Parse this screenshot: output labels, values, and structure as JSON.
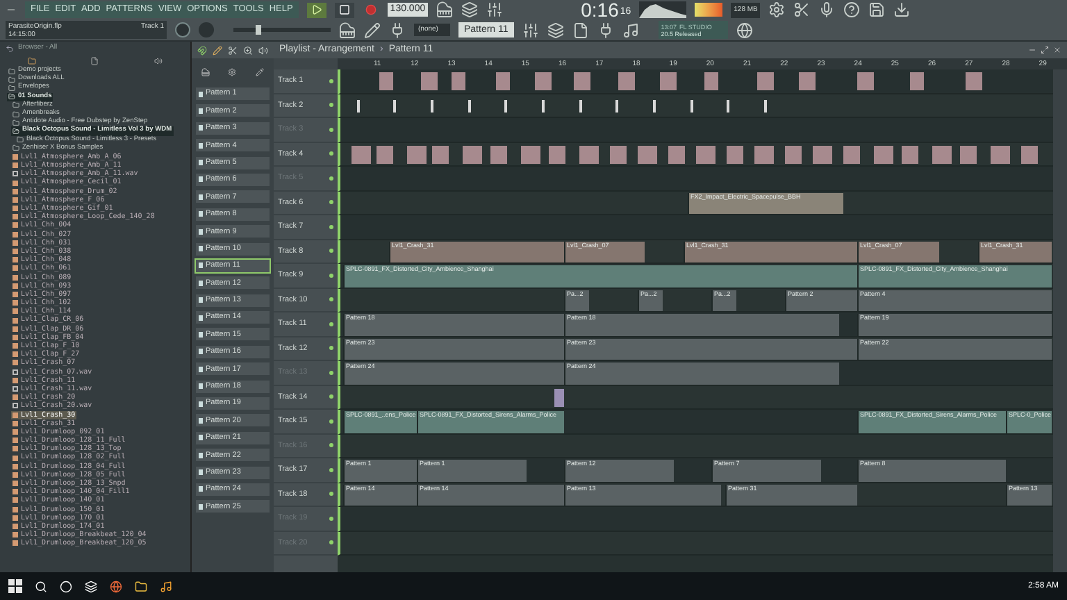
{
  "menu": [
    "FILE",
    "EDIT",
    "ADD",
    "PATTERNS",
    "VIEW",
    "OPTIONS",
    "TOOLS",
    "HELP"
  ],
  "transport": {
    "tempo": "130.000",
    "time": "0:16",
    "time_sub": "16",
    "memory": "128 MB"
  },
  "project": {
    "file": "ParasiteOrigin.flp",
    "time": "14:15:00",
    "track": "Track 1"
  },
  "snap": "(none)",
  "pattern_selector": "Pattern 11",
  "news": {
    "time": "13:07",
    "title": "FL STUDIO",
    "text": "20.5 Released"
  },
  "browser": {
    "title": "Browser - All",
    "folders": [
      {
        "name": "Demo projects",
        "expanded": false
      },
      {
        "name": "Downloads ALL",
        "expanded": false
      },
      {
        "name": "Envelopes",
        "expanded": false
      },
      {
        "name": "01 Sounds",
        "expanded": true,
        "children": [
          {
            "name": "Afterfiberz",
            "expanded": false
          },
          {
            "name": "Amenbreaks",
            "expanded": false
          },
          {
            "name": "Antidote Audio - Free Dubstep by ZenStep",
            "expanded": false
          },
          {
            "name": "Black Octopus Sound - Limitless Vol 3 by WDM",
            "expanded": true,
            "children": [
              {
                "name": "Black Octopus Sound - Limitless 3 - Presets",
                "expanded": false
              }
            ]
          },
          {
            "name": "Zenhiser X Bonus Samples",
            "expanded": false
          }
        ]
      }
    ],
    "files": [
      {
        "name": "Lvl1_Atmosphere_Amb_A_06",
        "kind": "sample",
        "selected": false
      },
      {
        "name": "Lvl1_Atmosphere_Amb_A_11",
        "kind": "sample",
        "selected": false
      },
      {
        "name": "Lvl1_Atmosphere_Amb_A_11.wav",
        "kind": "document",
        "selected": false
      },
      {
        "name": "Lvl1_Atmosphere_Cecil_01",
        "kind": "sample",
        "selected": false
      },
      {
        "name": "Lvl1_Atmosphere_Drum_02",
        "kind": "sample",
        "selected": false
      },
      {
        "name": "Lvl1_Atmosphere_F_06",
        "kind": "sample",
        "selected": false
      },
      {
        "name": "Lvl1_Atmosphere_Gif_01",
        "kind": "sample",
        "selected": false
      },
      {
        "name": "Lvl1_Atmosphere_Loop_Cede_140_28",
        "kind": "sample",
        "selected": false
      },
      {
        "name": "Lvl1_Chh_004",
        "kind": "sample",
        "selected": false
      },
      {
        "name": "Lvl1_Chh_027",
        "kind": "sample",
        "selected": false
      },
      {
        "name": "Lvl1_Chh_031",
        "kind": "sample",
        "selected": false
      },
      {
        "name": "Lvl1_Chh_038",
        "kind": "sample",
        "selected": false
      },
      {
        "name": "Lvl1_Chh_048",
        "kind": "sample",
        "selected": false
      },
      {
        "name": "Lvl1_Chh_061",
        "kind": "sample",
        "selected": false
      },
      {
        "name": "Lvl1_Chh_089",
        "kind": "sample",
        "selected": false
      },
      {
        "name": "Lvl1_Chh_093",
        "kind": "sample",
        "selected": false
      },
      {
        "name": "Lvl1_Chh_097",
        "kind": "sample",
        "selected": false
      },
      {
        "name": "Lvl1_Chh_102",
        "kind": "sample",
        "selected": false
      },
      {
        "name": "Lvl1_Chh_114",
        "kind": "sample",
        "selected": false
      },
      {
        "name": "Lvl1_Clap_CR_06",
        "kind": "sample",
        "selected": false
      },
      {
        "name": "Lvl1_Clap_DR_06",
        "kind": "sample",
        "selected": false
      },
      {
        "name": "Lvl1_Clap_FB_04",
        "kind": "sample",
        "selected": false
      },
      {
        "name": "Lvl1_Clap_F_10",
        "kind": "sample",
        "selected": false
      },
      {
        "name": "Lvl1_Clap_F_27",
        "kind": "sample",
        "selected": false
      },
      {
        "name": "Lvl1_Crash_07",
        "kind": "sample",
        "selected": false
      },
      {
        "name": "Lvl1_Crash_07.wav",
        "kind": "document",
        "selected": false
      },
      {
        "name": "Lvl1_Crash_11",
        "kind": "sample",
        "selected": false
      },
      {
        "name": "Lvl1_Crash_11.wav",
        "kind": "document",
        "selected": false
      },
      {
        "name": "Lvl1_Crash_20",
        "kind": "sample",
        "selected": false
      },
      {
        "name": "Lvl1_Crash_20.wav",
        "kind": "document",
        "selected": false
      },
      {
        "name": "Lvl1_Crash_30",
        "kind": "sample",
        "selected": true
      },
      {
        "name": "Lvl1_Crash_31",
        "kind": "sample",
        "selected": false
      },
      {
        "name": "Lvl1_Drumloop_092_01",
        "kind": "sample",
        "selected": false
      },
      {
        "name": "Lvl1_Drumloop_128_11_Full",
        "kind": "sample",
        "selected": false
      },
      {
        "name": "Lvl1_Drumloop_128_13_Top",
        "kind": "sample",
        "selected": false
      },
      {
        "name": "Lvl1_Drumloop_128_02_Full",
        "kind": "sample",
        "selected": false
      },
      {
        "name": "Lvl1_Drumloop_128_04_Full",
        "kind": "sample",
        "selected": false
      },
      {
        "name": "Lvl1_Drumloop_128_05_Full",
        "kind": "sample",
        "selected": false
      },
      {
        "name": "Lvl1_Drumloop_128_13_Snpd",
        "kind": "sample",
        "selected": false
      },
      {
        "name": "Lvl1_Drumloop_140_04_Fill1",
        "kind": "sample",
        "selected": false
      },
      {
        "name": "Lvl1_Drumloop_140_01",
        "kind": "sample",
        "selected": false
      },
      {
        "name": "Lvl1_Drumloop_150_01",
        "kind": "sample",
        "selected": false
      },
      {
        "name": "Lvl1_Drumloop_170_01",
        "kind": "sample",
        "selected": false
      },
      {
        "name": "Lvl1_Drumloop_174_01",
        "kind": "sample",
        "selected": false
      },
      {
        "name": "Lvl1_Drumloop_Breakbeat_120_04",
        "kind": "sample",
        "selected": false
      },
      {
        "name": "Lvl1_Drumloop_Breakbeat_120_05",
        "kind": "sample",
        "selected": false
      }
    ]
  },
  "patterns": [
    {
      "name": "Pattern 1",
      "selected": false
    },
    {
      "name": "Pattern 2",
      "selected": false
    },
    {
      "name": "Pattern 3",
      "selected": false
    },
    {
      "name": "Pattern 4",
      "selected": false
    },
    {
      "name": "Pattern 5",
      "selected": false
    },
    {
      "name": "Pattern 6",
      "selected": false
    },
    {
      "name": "Pattern 7",
      "selected": false
    },
    {
      "name": "Pattern 8",
      "selected": false
    },
    {
      "name": "Pattern 9",
      "selected": false
    },
    {
      "name": "Pattern 10",
      "selected": false
    },
    {
      "name": "Pattern 11",
      "selected": true
    },
    {
      "name": "Pattern 12",
      "selected": false
    },
    {
      "name": "Pattern 13",
      "selected": false
    },
    {
      "name": "Pattern 14",
      "selected": false
    },
    {
      "name": "Pattern 15",
      "selected": false
    },
    {
      "name": "Pattern 16",
      "selected": false
    },
    {
      "name": "Pattern 17",
      "selected": false
    },
    {
      "name": "Pattern 18",
      "selected": false
    },
    {
      "name": "Pattern 19",
      "selected": false
    },
    {
      "name": "Pattern 20",
      "selected": false
    },
    {
      "name": "Pattern 21",
      "selected": false
    },
    {
      "name": "Pattern 22",
      "selected": false
    },
    {
      "name": "Pattern 23",
      "selected": false
    },
    {
      "name": "Pattern 24",
      "selected": false
    },
    {
      "name": "Pattern 25",
      "selected": false
    }
  ],
  "playlist": {
    "title": "Playlist - Arrangement",
    "separator": "›",
    "pattern": "Pattern 11",
    "ruler": [
      "11",
      "12",
      "13",
      "14",
      "15",
      "16",
      "17",
      "18",
      "19",
      "20",
      "21",
      "22",
      "23",
      "24",
      "25",
      "26",
      "27",
      "28",
      "29"
    ],
    "tracks": [
      {
        "name": "Track 1",
        "active": true
      },
      {
        "name": "Track 2",
        "active": true
      },
      {
        "name": "Track 3",
        "active": false
      },
      {
        "name": "Track 4",
        "active": true
      },
      {
        "name": "Track 5",
        "active": false
      },
      {
        "name": "Track 6",
        "active": true,
        "clips": [
          {
            "label": "FX2_Impact_Electric_Spacepulse_BBH",
            "color": "#8a8478"
          }
        ]
      },
      {
        "name": "Track 7",
        "active": true
      },
      {
        "name": "Track 8",
        "active": true,
        "clips": [
          {
            "label": "Lvl1_Crash_31",
            "color": "#85766f"
          },
          {
            "label": "Lvl1_Crash_07",
            "color": "#85766f"
          },
          {
            "label": "Lvl1_Crash_31",
            "color": "#85766f"
          },
          {
            "label": "Lvl1_Crash_07",
            "color": "#85766f"
          },
          {
            "label": "Lvl1_Crash_31",
            "color": "#85766f"
          }
        ]
      },
      {
        "name": "Track 9",
        "active": true,
        "clips": [
          {
            "label": "SPLC-0891_FX_Distorted_City_Ambience_Shanghai",
            "color": "#5f7f78"
          },
          {
            "label": "SPLC-0891_FX_Distorted_City_Ambience_Shanghai",
            "color": "#5f7f78"
          }
        ]
      },
      {
        "name": "Track 10",
        "active": true,
        "clips": [
          {
            "label": "Pa...2",
            "color": "#5a6264"
          },
          {
            "label": "Pa...2",
            "color": "#5a6264"
          },
          {
            "label": "Pa...2",
            "color": "#5a6264"
          },
          {
            "label": "Pattern 2",
            "color": "#5a6264"
          },
          {
            "label": "Pattern 4",
            "color": "#5a6264"
          }
        ]
      },
      {
        "name": "Track 11",
        "active": true,
        "clips": [
          {
            "label": "Pattern 18",
            "color": "#5a6264"
          },
          {
            "label": "Pattern 18",
            "color": "#5a6264"
          },
          {
            "label": "Pattern 19",
            "color": "#5a6264"
          }
        ]
      },
      {
        "name": "Track 12",
        "active": true,
        "clips": [
          {
            "label": "Pattern 23",
            "color": "#5a6264"
          },
          {
            "label": "Pattern 23",
            "color": "#5a6264"
          },
          {
            "label": "Pattern 22",
            "color": "#5a6264"
          }
        ]
      },
      {
        "name": "Track 13",
        "active": false,
        "clips": [
          {
            "label": "Pattern 24",
            "color": "#5a6264"
          },
          {
            "label": "Pattern 24",
            "color": "#5a6264"
          }
        ]
      },
      {
        "name": "Track 14",
        "active": true
      },
      {
        "name": "Track 15",
        "active": true,
        "clips": [
          {
            "label": "SPLC-0891_..ens_Police",
            "color": "#5f7f78"
          },
          {
            "label": "SPLC-0891_FX_Distorted_Sirens_Alarms_Police",
            "color": "#5f7f78"
          },
          {
            "label": "SPLC-0891_FX_Distorted_Sirens_Alarms_Police",
            "color": "#5f7f78"
          },
          {
            "label": "SPLC-0_Police",
            "color": "#5f7f78"
          }
        ]
      },
      {
        "name": "Track 16",
        "active": false
      },
      {
        "name": "Track 17",
        "active": true,
        "clips": [
          {
            "label": "Pattern 1",
            "color": "#5a6264"
          },
          {
            "label": "Pattern 1",
            "color": "#5a6264"
          },
          {
            "label": "Pattern 12",
            "color": "#5a6264"
          },
          {
            "label": "Pattern 7",
            "color": "#5a6264"
          },
          {
            "label": "Pattern 8",
            "color": "#5a6264"
          }
        ]
      },
      {
        "name": "Track 18",
        "active": true,
        "clips": [
          {
            "label": "Pattern 14",
            "color": "#5a6264"
          },
          {
            "label": "Pattern 14",
            "color": "#5a6264"
          },
          {
            "label": "Pattern 13",
            "color": "#5a6264"
          },
          {
            "label": "Pattern 31",
            "color": "#5a6264"
          },
          {
            "label": "Pattern 13",
            "color": "#5a6264"
          }
        ]
      },
      {
        "name": "Track 19",
        "active": false
      },
      {
        "name": "Track 20",
        "active": false
      }
    ]
  },
  "taskbar": {
    "time": "2:58 AM"
  }
}
